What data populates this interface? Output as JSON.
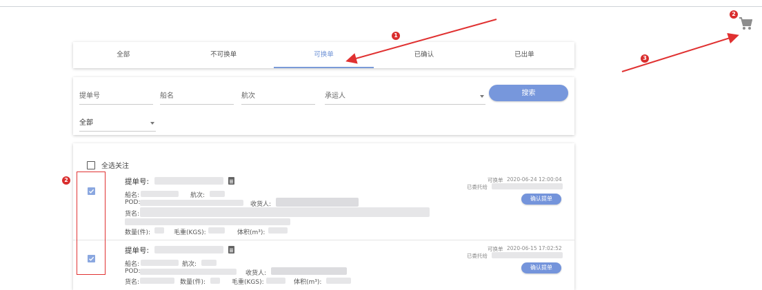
{
  "tabs": [
    {
      "label": "全部",
      "active": false
    },
    {
      "label": "不可换单",
      "active": false
    },
    {
      "label": "可换单",
      "active": true
    },
    {
      "label": "已确认",
      "active": false
    },
    {
      "label": "已出单",
      "active": false
    }
  ],
  "filters": {
    "bill_no": "提单号",
    "vessel": "船名",
    "voyage": "航次",
    "carrier": "承运人",
    "search_label": "搜索",
    "status_select": "全部"
  },
  "select_all_label": "全选关注",
  "records": [
    {
      "checked": true,
      "bill_label": "提单号:",
      "vessel_label": "船名:",
      "voyage_label": "航次:",
      "pod_label": "POD:",
      "consignee_label": "收货人:",
      "goods_label": "货名:",
      "qty_label": "数量(件):",
      "weight_label": "毛重(KGS):",
      "volume_label": "体积(m³):",
      "status": "可换单",
      "timestamp": "2020-06-24 12:00:04",
      "agent_label": "已委托给",
      "confirm_label": "确认提单"
    },
    {
      "checked": true,
      "bill_label": "提单号:",
      "vessel_label": "船名:",
      "voyage_label": "航次:",
      "pod_label": "POD:",
      "consignee_label": "收货人:",
      "goods_label": "货名:",
      "qty_label": "数量(件):",
      "weight_label": "毛重(KGS):",
      "volume_label": "体积(m³):",
      "status": "可换单",
      "timestamp": "2020-06-15 17:02:52",
      "agent_label": "已委托给",
      "confirm_label": "确认提单"
    }
  ],
  "annotations": {
    "marker_1": "1",
    "marker_2_cart": "2",
    "marker_3": "3",
    "marker_2_checkbox": "2"
  },
  "colors": {
    "accent": "#7797dc",
    "annotation_red": "#e03131"
  },
  "icons": {
    "cart": "cart-icon",
    "bill_document": "document-icon",
    "checkbox_checked": "checkbox-checked-icon",
    "dropdown": "chevron-down-icon"
  }
}
